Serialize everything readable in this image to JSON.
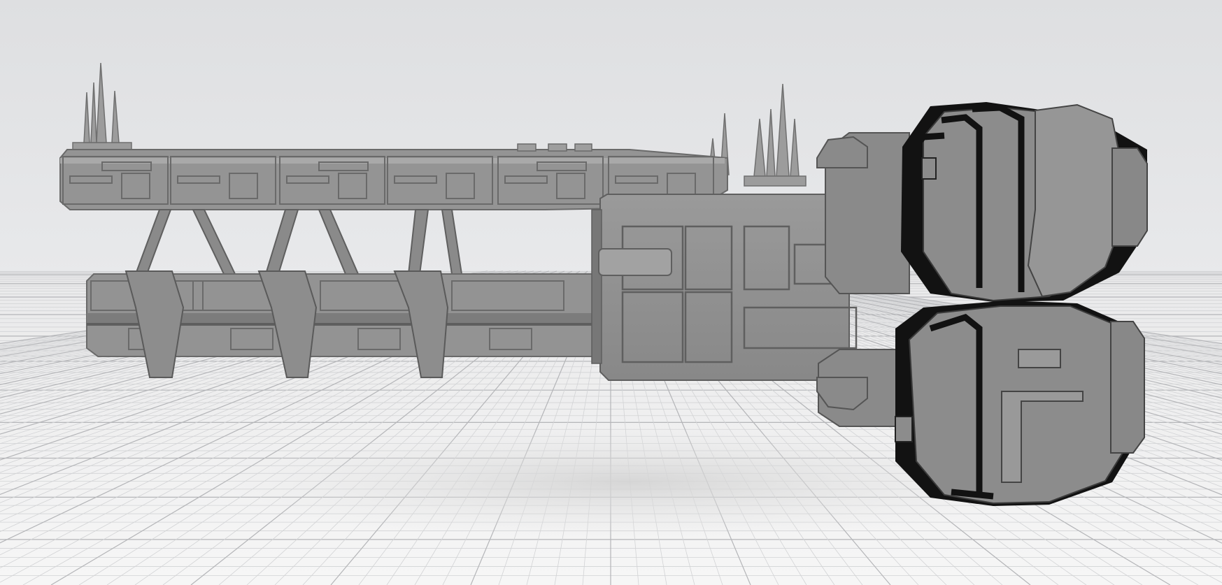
{
  "viewport": {
    "label": "",
    "colors": {
      "sky_top": "#dedfe1",
      "sky_bottom": "#e7e8ea",
      "floor": "#f4f4f4",
      "grid_minor": "#d2d3d5",
      "grid_major": "#b4b5b8",
      "model_base": "#8f8f8f",
      "model_light": "#a6a6a6",
      "model_mid": "#7d7d7d",
      "model_dark": "#5c5c5c",
      "model_shadow": "#141414",
      "floor_shadow": "#dadada"
    }
  },
  "model": {
    "name": "",
    "parts": [
      "upper-spine",
      "lower-spine",
      "truss-struts",
      "sensor-spikes",
      "central-hull",
      "engine-stack-upper",
      "engine-stack-lower"
    ]
  }
}
